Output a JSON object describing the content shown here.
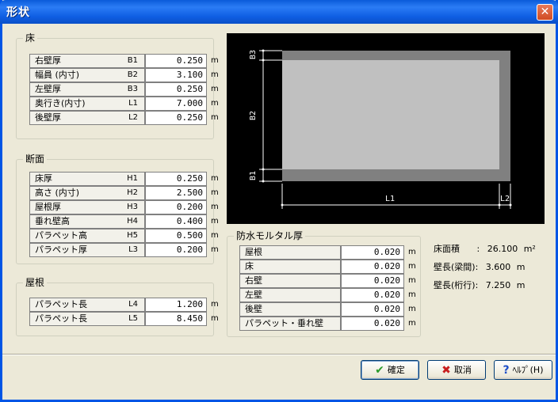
{
  "window": {
    "title": "形状",
    "close": "✕"
  },
  "floor": {
    "label": "床",
    "rows": [
      {
        "label": "右壁厚",
        "code": "B1",
        "value": "0.250",
        "unit": "m"
      },
      {
        "label": "幅員 (内寸)",
        "code": "B2",
        "value": "3.100",
        "unit": "m"
      },
      {
        "label": "左壁厚",
        "code": "B3",
        "value": "0.250",
        "unit": "m"
      },
      {
        "label": "奥行き(内寸)",
        "code": "L1",
        "value": "7.000",
        "unit": "m"
      },
      {
        "label": "後壁厚",
        "code": "L2",
        "value": "0.250",
        "unit": "m"
      }
    ]
  },
  "section": {
    "label": "断面",
    "rows": [
      {
        "label": "床厚",
        "code": "H1",
        "value": "0.250",
        "unit": "m"
      },
      {
        "label": "高さ (内寸)",
        "code": "H2",
        "value": "2.500",
        "unit": "m"
      },
      {
        "label": "屋根厚",
        "code": "H3",
        "value": "0.200",
        "unit": "m"
      },
      {
        "label": "垂れ壁高",
        "code": "H4",
        "value": "0.400",
        "unit": "m"
      },
      {
        "label": "パラペット高",
        "code": "H5",
        "value": "0.500",
        "unit": "m"
      },
      {
        "label": "パラペット厚",
        "code": "L3",
        "value": "0.200",
        "unit": "m"
      }
    ]
  },
  "roof": {
    "label": "屋根",
    "rows": [
      {
        "label": "パラペット長",
        "code": "L4",
        "value": "1.200",
        "unit": "m"
      },
      {
        "label": "パラペット長",
        "code": "L5",
        "value": "8.450",
        "unit": "m"
      }
    ]
  },
  "mortar": {
    "label": "防水モルタル厚",
    "rows": [
      {
        "label": "屋根",
        "value": "0.020",
        "unit": "m"
      },
      {
        "label": "床",
        "value": "0.020",
        "unit": "m"
      },
      {
        "label": "右壁",
        "value": "0.020",
        "unit": "m"
      },
      {
        "label": "左壁",
        "value": "0.020",
        "unit": "m"
      },
      {
        "label": "後壁",
        "value": "0.020",
        "unit": "m"
      },
      {
        "label": "パラペット・垂れ壁",
        "value": "0.020",
        "unit": "m"
      }
    ]
  },
  "drawing": {
    "b1": "B1",
    "b2": "B2",
    "b3": "B3",
    "l1": "L1",
    "l2": "L2"
  },
  "info": {
    "area_label": "床面積",
    "area_colon": ":",
    "area_value": "26.100",
    "area_unit": "m²",
    "beam_label": "壁長(梁間):",
    "beam_value": "3.600",
    "beam_unit": "m",
    "girder_label": "壁長(桁行):",
    "girder_value": "7.250",
    "girder_unit": "m"
  },
  "buttons": {
    "ok_icon": "✔",
    "ok": "確定",
    "cancel_icon": "✖",
    "cancel": "取消",
    "help_icon": "?",
    "help": "ﾍﾙﾌﾟ(H)"
  }
}
